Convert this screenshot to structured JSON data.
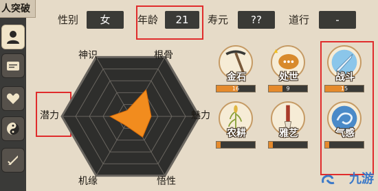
{
  "header": {
    "title_fragment": "人突破"
  },
  "sidebar": {
    "items": [
      {
        "name": "profile",
        "icon": "person-icon",
        "active": true
      },
      {
        "name": "cards",
        "icon": "card-icon",
        "active": false
      },
      {
        "name": "hearts",
        "icon": "heart-icon",
        "active": false
      },
      {
        "name": "taiji",
        "icon": "yin-yang-icon",
        "active": false
      },
      {
        "name": "gear",
        "icon": "sword-icon",
        "active": false
      }
    ]
  },
  "stats": {
    "gender_label": "性别",
    "gender_value": "女",
    "age_label": "年龄",
    "age_value": "21",
    "lifespan_label": "寿元",
    "lifespan_value": "??",
    "dao_label": "道行",
    "dao_value": "-"
  },
  "radar": {
    "labels": {
      "top_left": "神识",
      "top_right": "根骨",
      "left": "潜力",
      "right": "魅力",
      "bottom_left": "机缘",
      "bottom_right": "悟性"
    },
    "values": {
      "top_left": 0.1,
      "top_right": 0.45,
      "right": 0.3,
      "bottom_right": 0.35,
      "bottom_left": 0.15,
      "left": 0.3
    },
    "fill_color": "#f28c1e"
  },
  "skills": [
    {
      "name": "金石",
      "level": "16",
      "progress": 0.55,
      "icon": "pickaxe-icon"
    },
    {
      "name": "处世",
      "level": "9",
      "progress": 0.35,
      "icon": "speech-bubble-icon"
    },
    {
      "name": "战斗",
      "level": "15",
      "progress": 0.5,
      "icon": "sword-icon"
    },
    {
      "name": "农耕",
      "level": "",
      "progress": 0.1,
      "icon": "wheat-icon"
    },
    {
      "name": "雅艺",
      "level": "",
      "progress": 0.1,
      "icon": "brush-icon"
    },
    {
      "name": "气感",
      "level": "",
      "progress": 0.1,
      "icon": "qi-swirl-icon"
    }
  ],
  "watermark": {
    "text": "九游"
  }
}
